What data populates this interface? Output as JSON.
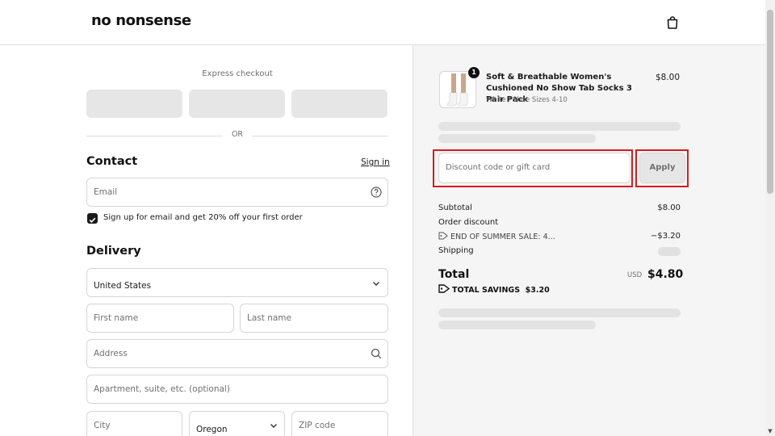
{
  "header": {
    "logo": "no nonsense",
    "cart_icon": "shopping-bag-icon"
  },
  "checkout": {
    "express_label": "Express checkout",
    "or_label": "OR",
    "contact": {
      "title": "Contact",
      "sign_in": "Sign in",
      "email_placeholder": "Email",
      "newsletter_label": "Sign up for email and get 20% off your first order",
      "newsletter_checked": true
    },
    "delivery": {
      "title": "Delivery",
      "country_value": "United States",
      "first_name_placeholder": "First name",
      "last_name_placeholder": "Last name",
      "address_placeholder": "Address",
      "apartment_placeholder": "Apartment, suite, etc. (optional)",
      "city_placeholder": "City",
      "state_value": "Oregon",
      "zip_placeholder": "ZIP code"
    }
  },
  "summary": {
    "product": {
      "name": "Soft & Breathable Women's Cushioned No Show Tab Socks 3 Pair Pack",
      "variant": "White / Shoe Sizes 4-10",
      "price": "$8.00",
      "quantity": "1"
    },
    "discount_placeholder": "Discount code or gift card",
    "apply_label": "Apply",
    "subtotal_label": "Subtotal",
    "subtotal_value": "$8.00",
    "order_discount_label": "Order discount",
    "discount_code": "END OF SUMMER SALE: 4...",
    "discount_value": "−$3.20",
    "shipping_label": "Shipping",
    "total_label": "Total",
    "total_currency": "USD",
    "total_value": "$4.80",
    "savings_label": "TOTAL SAVINGS",
    "savings_value": "$3.20"
  },
  "colors": {
    "highlight": "#d81b1b",
    "summary_bg": "#f5f5f5",
    "text": "#1a1a1a"
  }
}
